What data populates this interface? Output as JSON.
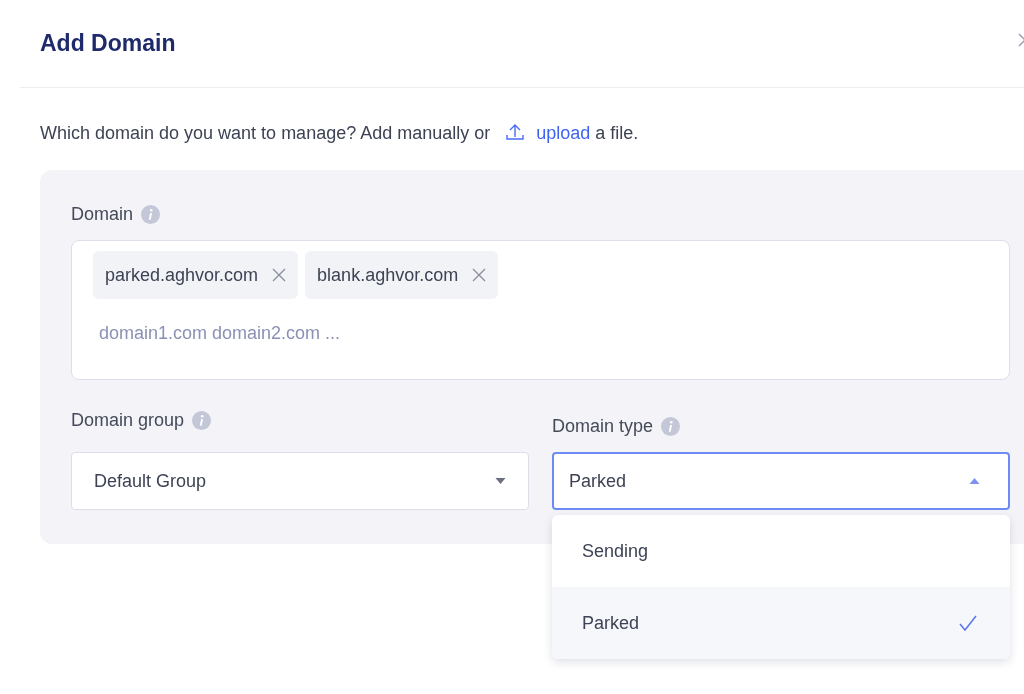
{
  "dialog": {
    "title": "Add Domain"
  },
  "intro": {
    "before": "Which domain do you want to manage? Add manually or",
    "link": "upload",
    "after": "a file."
  },
  "domain": {
    "label": "Domain",
    "tags": [
      "parked.aghvor.com",
      "blank.aghvor.com"
    ],
    "placeholder": "domain1.com domain2.com ..."
  },
  "domain_group": {
    "label": "Domain group",
    "value": "Default Group",
    "expanded": false
  },
  "domain_type": {
    "label": "Domain type",
    "value": "Parked",
    "expanded": true,
    "options": [
      {
        "label": "Sending",
        "selected": false
      },
      {
        "label": "Parked",
        "selected": true
      }
    ]
  }
}
